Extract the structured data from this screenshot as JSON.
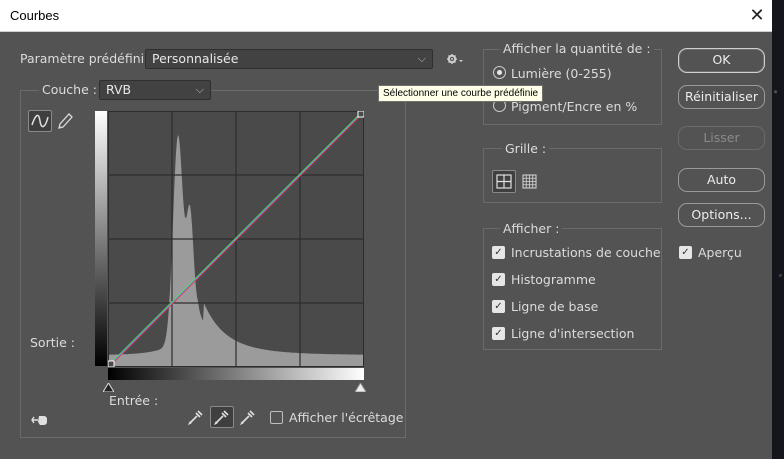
{
  "window": {
    "title": "Courbes",
    "close_glyph": "✕"
  },
  "preset": {
    "label": "Paramètre prédéfini :",
    "value": "Personnalisée",
    "options_icon": "gear-icon"
  },
  "tooltip": {
    "text": "Sélectionner une courbe prédéfinie"
  },
  "channel": {
    "label": "Couche :",
    "value": "RVB"
  },
  "tools": {
    "curve_tool_icon": "curve-icon",
    "pencil_tool_icon": "pencil-icon",
    "target_tool_icon": "hand-adjust-icon"
  },
  "graph": {
    "output_label": "Sortie :",
    "input_label": "Entrée :",
    "curve": [
      [
        0,
        0
      ],
      [
        255,
        255
      ]
    ],
    "grid_divisions": 4
  },
  "eyedroppers": {
    "black_icon": "eyedropper-black-icon",
    "gray_icon": "eyedropper-gray-icon",
    "white_icon": "eyedropper-white-icon"
  },
  "clipping": {
    "label": "Afficher l'écrêtage",
    "checked": false
  },
  "show_amount": {
    "title": "Afficher la quantité de :",
    "options": [
      {
        "label": "Lumière (0-255)",
        "selected": true
      },
      {
        "label": "Pigment/Encre en %",
        "selected": false
      }
    ]
  },
  "grid": {
    "title": "Grille :",
    "simple_icon": "grid-4-icon",
    "detailed_icon": "grid-10-icon"
  },
  "display": {
    "title": "Afficher :",
    "items": [
      {
        "label": "Incrustations de couche",
        "checked": true
      },
      {
        "label": "Histogramme",
        "checked": true
      },
      {
        "label": "Ligne de base",
        "checked": true
      },
      {
        "label": "Ligne d'intersection",
        "checked": true
      }
    ]
  },
  "buttons": {
    "ok": "OK",
    "reset": "Réinitialiser",
    "smooth": "Lisser",
    "auto": "Auto",
    "options": "Options..."
  },
  "preview": {
    "label": "Aperçu",
    "checked": true
  },
  "colors": {
    "dialog_bg": "#535353",
    "graph_bg": "#4a4a4a",
    "histogram": "#9b9b9b",
    "curve_red": "#ff3b3b",
    "curve_green": "#3bff3b",
    "curve_blue": "#3b3bff"
  }
}
